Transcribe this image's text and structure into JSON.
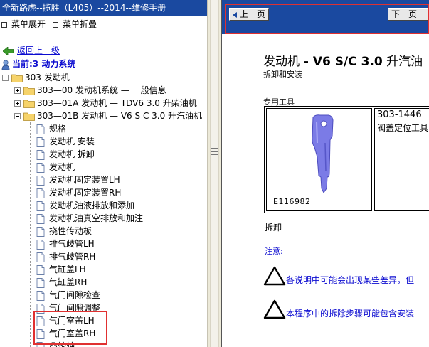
{
  "left": {
    "title": "全新路虎--揽胜（L405）--2014--维修手册",
    "expand_label": "菜单展开",
    "collapse_label": "菜单折叠",
    "back_label": "返回上一级",
    "current_label": "当前:3 动力系统",
    "tree": {
      "root": "303 发动机",
      "groups": [
        {
          "label": "303—00 发动机系统 — 一般信息",
          "state": "collapsed"
        },
        {
          "label": "303—01A 发动机 — TDV6 3.0 升柴油机",
          "state": "collapsed"
        },
        {
          "label": "303—01B 发动机 — V6 S C 3.0 升汽油机",
          "state": "expanded"
        }
      ],
      "leaves": [
        "规格",
        "发动机 安装",
        "发动机 拆卸",
        "发动机",
        "发动机固定装置LH",
        "发动机固定装置RH",
        "发动机油液排放和添加",
        "发动机油真空排放和加注",
        "挠性传动板",
        "排气歧管LH",
        "排气歧管RH",
        "气缸盖LH",
        "气缸盖RH",
        "气门间隙检查",
        "气门间隙调整",
        "气门室盖LH",
        "气门室盖RH",
        "凸轮轴"
      ]
    }
  },
  "right": {
    "prev_label": "上一页",
    "next_label": "下一页",
    "title_prefix": "发动机",
    "title_bold": " - V6 S/C 3.0",
    "title_suffix": " 升汽油",
    "subtitle": "拆卸和安装",
    "tools_label": "专用工具",
    "tool_number": "303-1446",
    "tool_name": "阀盖定位工具",
    "figure_code": "E116982",
    "removal_label": "拆卸",
    "note_label": "注意:",
    "warnings": [
      "各说明中可能会出现某些差异，但",
      "本程序中的拆除步骤可能包含安装"
    ]
  },
  "colors": {
    "title_bar": "#1a49a0",
    "link": "#0b0bd0",
    "highlight": "#e03030",
    "tool_fill": "#7b7be6"
  }
}
